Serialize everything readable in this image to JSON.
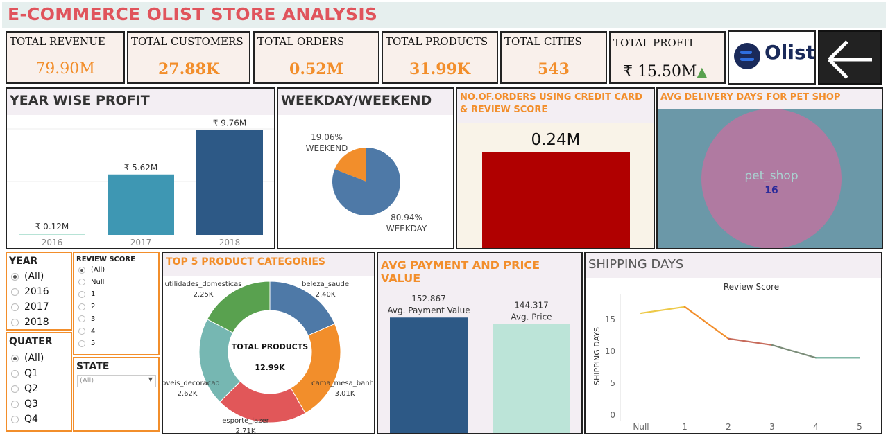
{
  "title": "E-COMMERCE OLIST STORE ANALYSIS",
  "kpis": {
    "revenue": {
      "label": "TOTAL REVENUE",
      "value": "79.90M"
    },
    "customers": {
      "label": "TOTAL CUSTOMERS",
      "value": "27.88K"
    },
    "orders": {
      "label": "TOTAL ORDERS",
      "value": "0.52M"
    },
    "products": {
      "label": "TOTAL PRODUCTS",
      "value": "31.99K"
    },
    "cities": {
      "label": "TOTAL CITIES",
      "value": "543"
    },
    "profit": {
      "label": "TOTAL PROFIT",
      "value": "₹ 15.50M",
      "trend": "▲"
    }
  },
  "logo": {
    "text": "Olist",
    "brand_color": "#1a2a5a"
  },
  "back_icon": "arrow-left-icon",
  "panels": {
    "year_profit": "YEAR WISE PROFIT",
    "weekday": "WEEKDAY/WEEKEND",
    "credit": "NO.OF.ORDERS USING CREDIT CARD & REVIEW SCORE",
    "delivery": "AVG DELIVERY DAYS FOR PET SHOP",
    "top5": "TOP 5 PRODUCT CATEGORIES",
    "avgpay": "AVG PAYMENT AND PRICE VALUE",
    "shipping": "SHIPPING DAYS"
  },
  "filters": {
    "year": {
      "title": "YEAR",
      "options": [
        "(All)",
        "2016",
        "2017",
        "2018"
      ],
      "selected": 0
    },
    "review": {
      "title": "REVIEW SCORE",
      "options": [
        "(All)",
        "Null",
        "1",
        "2",
        "3",
        "4",
        "5"
      ],
      "selected": 0
    },
    "quarter": {
      "title": "QUATER",
      "options": [
        "(All)",
        "Q1",
        "Q2",
        "Q3",
        "Q4"
      ],
      "selected": 0
    },
    "state": {
      "title": "STATE",
      "value": "(All)"
    }
  },
  "chart_data": [
    {
      "id": "year_profit",
      "type": "bar",
      "title": "YEAR WISE PROFIT",
      "categories": [
        "2016",
        "2017",
        "2018"
      ],
      "values": [
        0.12,
        5.62,
        9.76
      ],
      "labels": [
        "₹ 0.12M",
        "₹ 5.62M",
        "₹ 9.76M"
      ],
      "colors": [
        "#b7e3d6",
        "#3e97b3",
        "#2d5986"
      ],
      "ylim": [
        0,
        10.5
      ]
    },
    {
      "id": "weekday",
      "type": "pie",
      "title": "WEEKDAY/WEEKEND",
      "slices": [
        {
          "name": "WEEKEND",
          "value": 19.06,
          "label": "19.06%",
          "color": "#f28e2b"
        },
        {
          "name": "WEEKDAY",
          "value": 80.94,
          "label": "80.94%",
          "color": "#4e79a7"
        }
      ]
    },
    {
      "id": "credit",
      "type": "bar",
      "title": "NO.OF.ORDERS USING CREDIT CARD & REVIEW SCORE",
      "values": [
        0.24
      ],
      "labels": [
        "0.24M"
      ],
      "colors": [
        "#b00000"
      ]
    },
    {
      "id": "delivery",
      "type": "pie",
      "title": "AVG DELIVERY DAYS FOR PET SHOP",
      "slices": [
        {
          "name": "pet_shop",
          "value": 16,
          "label": "16",
          "color": "#b07aa1"
        }
      ],
      "background": "#6b98a8"
    },
    {
      "id": "top5",
      "type": "pie",
      "title": "TOP 5 PRODUCT CATEGORIES",
      "center_label": "TOTAL PRODUCTS",
      "center_value": "12.99K",
      "slices": [
        {
          "name": "beleza_saude",
          "value": 2.4,
          "label": "2.40K",
          "color": "#4e79a7"
        },
        {
          "name": "cama_mesa_banho",
          "value": 3.01,
          "label": "3.01K",
          "color": "#f28e2b"
        },
        {
          "name": "esporte_lazer",
          "value": 2.71,
          "label": "2.71K",
          "color": "#e15759"
        },
        {
          "name": "moveis_decoracao",
          "value": 2.62,
          "label": "2.62K",
          "color": "#76b7b2"
        },
        {
          "name": "utilidades_domesticas",
          "value": 2.25,
          "label": "2.25K",
          "color": "#59a14f"
        }
      ]
    },
    {
      "id": "avgpay",
      "type": "bar",
      "title": "AVG PAYMENT AND PRICE VALUE",
      "categories": [
        "Avg. Payment Value",
        "Avg. Price"
      ],
      "values": [
        152.867,
        144.317
      ],
      "labels": [
        "152.867",
        "144.317"
      ],
      "colors": [
        "#2d5986",
        "#bce4d8"
      ],
      "ylim": [
        0,
        165
      ]
    },
    {
      "id": "shipping",
      "type": "line",
      "title": "SHIPPING DAYS",
      "xlabel": "Review Score",
      "ylabel": "SHIPPING DAYS",
      "x": [
        "Null",
        "1",
        "2",
        "3",
        "4",
        "5"
      ],
      "y": [
        16,
        17,
        12,
        11,
        9,
        9
      ],
      "yticks": [
        0,
        5,
        10,
        15
      ],
      "ylim": [
        0,
        18.5
      ]
    }
  ]
}
